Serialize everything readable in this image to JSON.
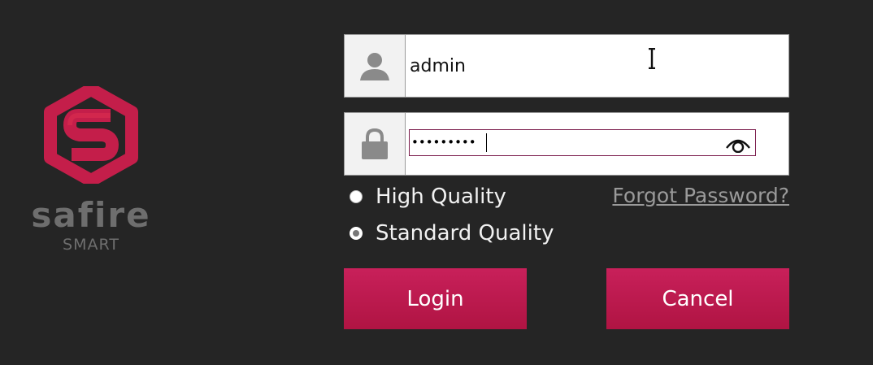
{
  "brand": {
    "name": "safire",
    "sub": "SMART",
    "logo_icon": "hexagon-s-logo",
    "accent_color": "#c41e4a"
  },
  "login": {
    "username_icon": "user-icon",
    "username_value": "admin",
    "password_icon": "lock-icon",
    "password_value": "•••••••••",
    "show_password_icon": "eye-icon"
  },
  "quality": {
    "options": [
      {
        "label": "High Quality",
        "checked": false
      },
      {
        "label": "Standard Quality",
        "checked": true
      }
    ]
  },
  "links": {
    "forgot_password": "Forgot Password?"
  },
  "buttons": {
    "login": "Login",
    "cancel": "Cancel",
    "color": "#c41e4a"
  }
}
